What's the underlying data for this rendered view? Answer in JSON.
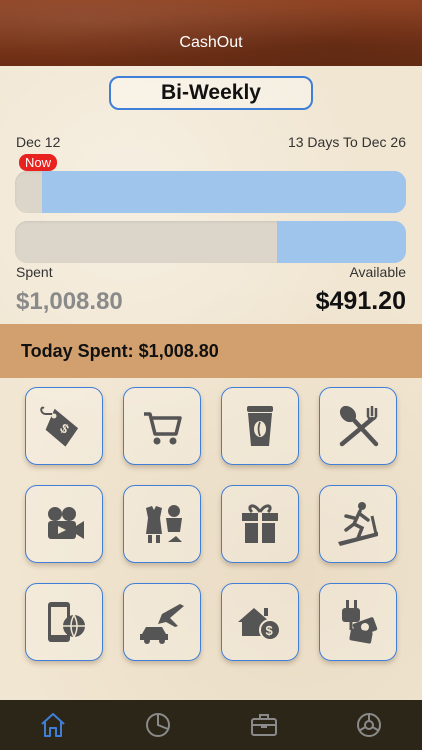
{
  "app": {
    "title": "CashOut"
  },
  "period": {
    "label": "Bi-Weekly"
  },
  "timeline": {
    "start_date": "Dec 12",
    "remaining_label": "13 Days To Dec 26",
    "now_badge": "Now",
    "elapsed_fraction": 0.07
  },
  "budget": {
    "spent_label": "Spent",
    "available_label": "Available",
    "spent_amount": "$1,008.80",
    "available_amount": "$491.20",
    "available_fraction": 0.33
  },
  "today": {
    "label": "Today Spent: $1,008.80"
  },
  "categories": [
    {
      "icon": "price-tag-icon"
    },
    {
      "icon": "shopping-cart-icon"
    },
    {
      "icon": "coffee-cup-icon"
    },
    {
      "icon": "spoon-fork-icon"
    },
    {
      "icon": "movie-camera-icon"
    },
    {
      "icon": "clothing-icon"
    },
    {
      "icon": "gift-icon"
    },
    {
      "icon": "treadmill-icon"
    },
    {
      "icon": "phone-globe-icon"
    },
    {
      "icon": "car-plane-icon"
    },
    {
      "icon": "house-money-icon"
    },
    {
      "icon": "utility-bill-icon"
    }
  ],
  "tabs": [
    {
      "icon": "home-icon",
      "active": true
    },
    {
      "icon": "pie-chart-icon",
      "active": false
    },
    {
      "icon": "briefcase-icon",
      "active": false
    },
    {
      "icon": "settings-gear-icon",
      "active": false
    }
  ],
  "colors": {
    "accent_blue": "#3f7fd8",
    "bar_fill": "#9fc5ec",
    "now_red": "#e8221e",
    "band_tan": "#d1a06e",
    "tabbar_bg": "#2c2618"
  }
}
